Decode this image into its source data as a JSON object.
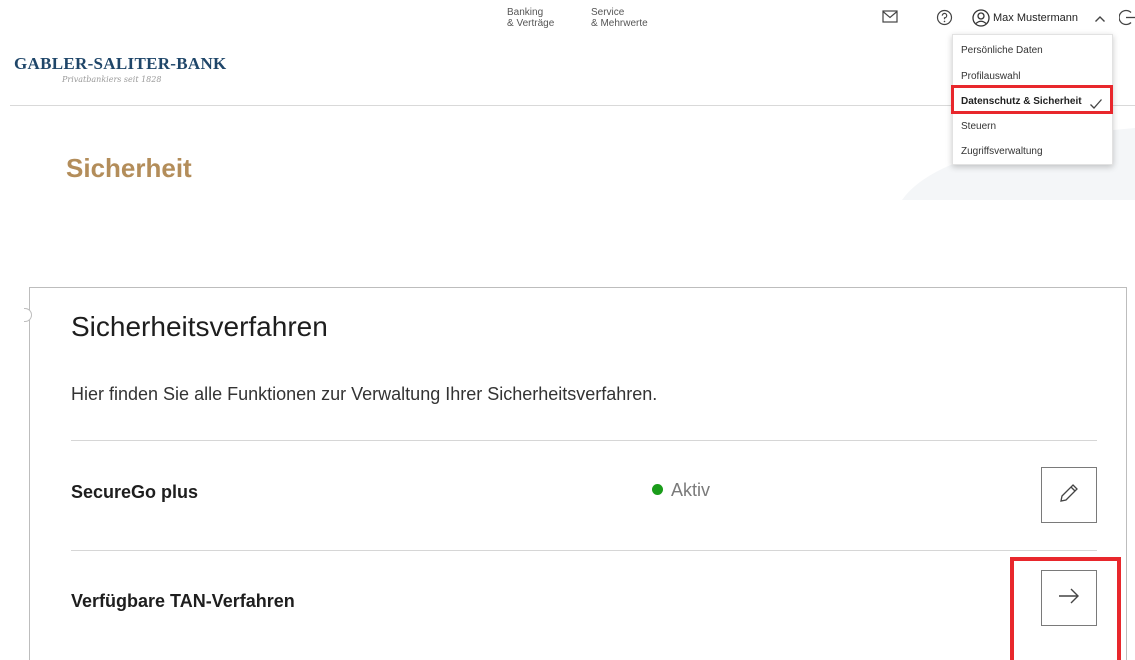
{
  "brand": {
    "name": "GABLER-SALITER-BANK",
    "tagline": "Privatbankiers seit 1828"
  },
  "nav": {
    "banking": [
      "Banking",
      "& Verträge"
    ],
    "service": [
      "Service",
      "& Mehrwerte"
    ]
  },
  "user": {
    "name": "Max Mustermann"
  },
  "dropdown": {
    "items": [
      "Persönliche Daten",
      "Profilauswahl",
      "Datenschutz & Sicherheit",
      "Steuern",
      "Zugriffsverwaltung"
    ],
    "selected_index": 2
  },
  "page": {
    "title": "Sicherheit"
  },
  "card": {
    "title": "Sicherheitsverfahren",
    "description": "Hier finden Sie alle Funktionen zur Verwaltung Ihrer Sicherheitsverfahren.",
    "rows": [
      {
        "label": "SecureGo plus",
        "status": "Aktiv",
        "action_icon": "pencil-icon"
      },
      {
        "label": "Verfügbare TAN-Verfahren",
        "action_icon": "arrow-right-icon"
      }
    ]
  },
  "colors": {
    "brand": "#1f4669",
    "title_gold": "#b38d5a",
    "status_active": "#1a9c1a",
    "highlight": "#e8272c"
  },
  "icons": [
    "mail-icon",
    "help-icon",
    "user-icon",
    "chevron-up-icon",
    "logout-icon",
    "check-icon",
    "pencil-icon",
    "arrow-right-icon"
  ]
}
